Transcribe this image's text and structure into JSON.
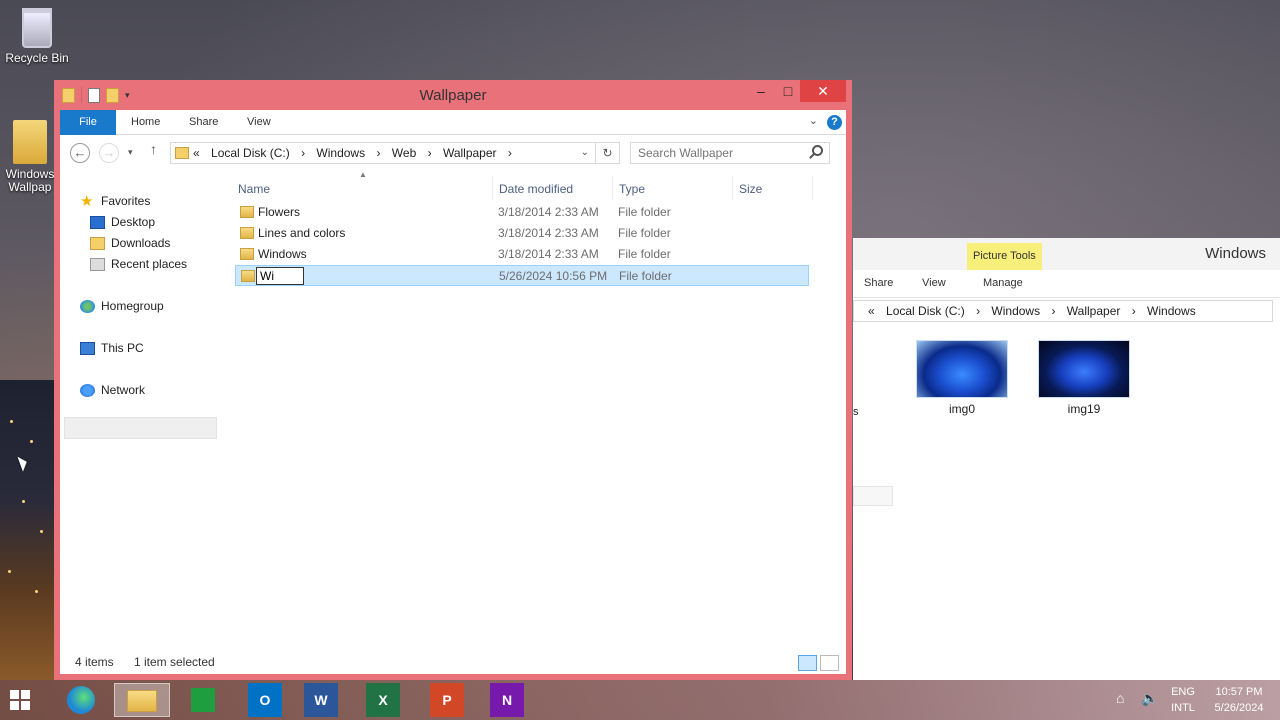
{
  "desktop": {
    "icons": [
      {
        "label": "Recycle Bin"
      },
      {
        "label": "Windows Wallpap"
      }
    ]
  },
  "back_window": {
    "contextual_tab": "Picture Tools",
    "title": "Windows",
    "ribbon_tabs": [
      "Share",
      "View",
      "Manage"
    ],
    "breadcrumb": [
      "«",
      "Local Disk (C:)",
      "›",
      "Windows",
      "›",
      "Wallpaper",
      "›",
      "Windows"
    ],
    "partial_text": "s",
    "thumbnails": [
      {
        "label": "img0"
      },
      {
        "label": "img19"
      }
    ]
  },
  "window": {
    "title": "Wallpaper",
    "controls": {
      "minimize": "–",
      "maximize": "□",
      "close": "✕"
    },
    "ribbon_tabs": {
      "file": "File",
      "home": "Home",
      "share": "Share",
      "view": "View"
    },
    "help": "?",
    "nav": {
      "back": "←",
      "forward": "→",
      "recent": "▾",
      "up": "↑"
    },
    "breadcrumb": [
      "«",
      "Local Disk (C:)",
      "›",
      "Windows",
      "›",
      "Web",
      "›",
      "Wallpaper",
      "›"
    ],
    "search_placeholder": "Search Wallpaper",
    "nav_pane": {
      "favorites": "Favorites",
      "desktop": "Desktop",
      "downloads": "Downloads",
      "recent": "Recent places",
      "homegroup": "Homegroup",
      "thispc": "This PC",
      "network": "Network"
    },
    "columns": {
      "name": "Name",
      "date": "Date modified",
      "type": "Type",
      "size": "Size"
    },
    "files": [
      {
        "name": "Flowers",
        "date": "3/18/2014 2:33 AM",
        "type": "File folder"
      },
      {
        "name": "Lines and colors",
        "date": "3/18/2014 2:33 AM",
        "type": "File folder"
      },
      {
        "name": "Windows",
        "date": "3/18/2014 2:33 AM",
        "type": "File folder"
      },
      {
        "name": "Wi",
        "date": "5/26/2024 10:56 PM",
        "type": "File folder",
        "renaming": true
      }
    ],
    "status": {
      "count": "4 items",
      "selected": "1 item selected"
    }
  },
  "taskbar": {
    "apps": [
      {
        "icon": "edge-icon",
        "label": ""
      },
      {
        "icon": "file-explorer-icon",
        "label": ""
      },
      {
        "icon": "store-icon",
        "label": ""
      },
      {
        "icon": "outlook-icon",
        "label": "O"
      },
      {
        "icon": "word-icon",
        "label": "W"
      },
      {
        "icon": "excel-icon",
        "label": "X"
      },
      {
        "icon": "powerpoint-icon",
        "label": "P"
      },
      {
        "icon": "onenote-icon",
        "label": "N"
      }
    ],
    "lang_top": "ENG",
    "lang_bottom": "INTL",
    "time": "10:57 PM",
    "date": "5/26/2024",
    "colors": {
      "word": "#2b579a",
      "excel": "#217346",
      "powerpoint": "#d24726",
      "onenote": "#7719aa",
      "outlook": "#0072c6",
      "store": "#1e9e3e",
      "edge": "#1e88d6"
    }
  }
}
